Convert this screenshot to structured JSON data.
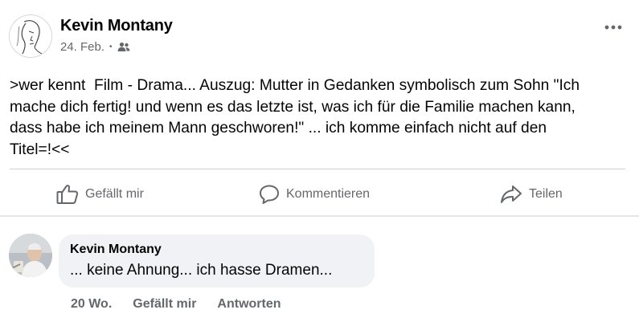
{
  "post": {
    "author": "Kevin Montany",
    "date": "24. Feb.",
    "separator": "•",
    "audience_icon": "friends-icon",
    "more_icon": "more-options-icon",
    "text": ">wer kennt  Film - Drama... Auszug: Mutter in Gedanken symbolisch zum Sohn \"Ich\nmache dich fertig! und wenn es das letzte ist, was ich für die Familie machen kann,\ndass habe ich meinem Mann geschworen!\" ... ich komme einfach nicht auf den\nTitel=!<<"
  },
  "actions": {
    "like_label": "Gefällt mir",
    "comment_label": "Kommentieren",
    "share_label": "Teilen"
  },
  "comment": {
    "author": "Kevin Montany",
    "text": "... keine Ahnung... ich hasse Dramen...",
    "time": "20 Wo.",
    "like_label": "Gefällt mir",
    "reply_label": "Antworten"
  },
  "colors": {
    "secondary_text": "#65676b",
    "bubble_bg": "#f0f2f5",
    "divider": "#ced0d4"
  }
}
